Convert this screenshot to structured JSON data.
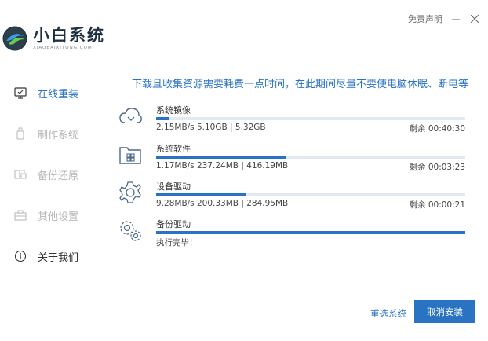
{
  "window": {
    "disclaimer_link": "免责声明",
    "minimize_icon": "minimize-icon",
    "close_icon": "close-icon"
  },
  "logo": {
    "name": "小白系统",
    "subtitle": "XIAOBAIXITONG.COM"
  },
  "sidebar": {
    "items": [
      {
        "label": "在线重装",
        "icon": "monitor-icon",
        "state": "active"
      },
      {
        "label": "制作系统",
        "icon": "usb-drive-icon",
        "state": "disabled"
      },
      {
        "label": "备份还原",
        "icon": "backup-icon",
        "state": "disabled"
      },
      {
        "label": "其他设置",
        "icon": "toolbox-icon",
        "state": "disabled"
      },
      {
        "label": "关于我们",
        "icon": "info-icon",
        "state": "normal"
      }
    ]
  },
  "main": {
    "notice": "下载且收集资源需要耗费一点时间，在此期间尽量不要使电脑休眠、断电等",
    "tasks": [
      {
        "name": "系统镜像",
        "icon": "cloud-download-icon",
        "detail": "2.15MB/s 5.10GB | 5.32GB",
        "remaining": "剩余 00:40:30",
        "progress": 0.04
      },
      {
        "name": "系统软件",
        "icon": "software-folder-icon",
        "detail": "1.17MB/s 237.24MB | 416.19MB",
        "remaining": "剩余 00:03:23",
        "progress": 0.42
      },
      {
        "name": "设备驱动",
        "icon": "gear-icon",
        "detail": "9.28MB/s 200.33MB | 284.95MB",
        "remaining": "剩余 00:00:21",
        "progress": 0.29
      },
      {
        "name": "备份驱动",
        "icon": "gears-icon",
        "detail": "执行完毕！",
        "remaining": "",
        "progress": 1.0
      }
    ],
    "reselect_button": "重选系统",
    "cancel_button": "取消安装"
  },
  "colors": {
    "accent": "#2a73c2",
    "bar_track": "#e3e9f0",
    "disabled_text": "#b7b7b7"
  }
}
